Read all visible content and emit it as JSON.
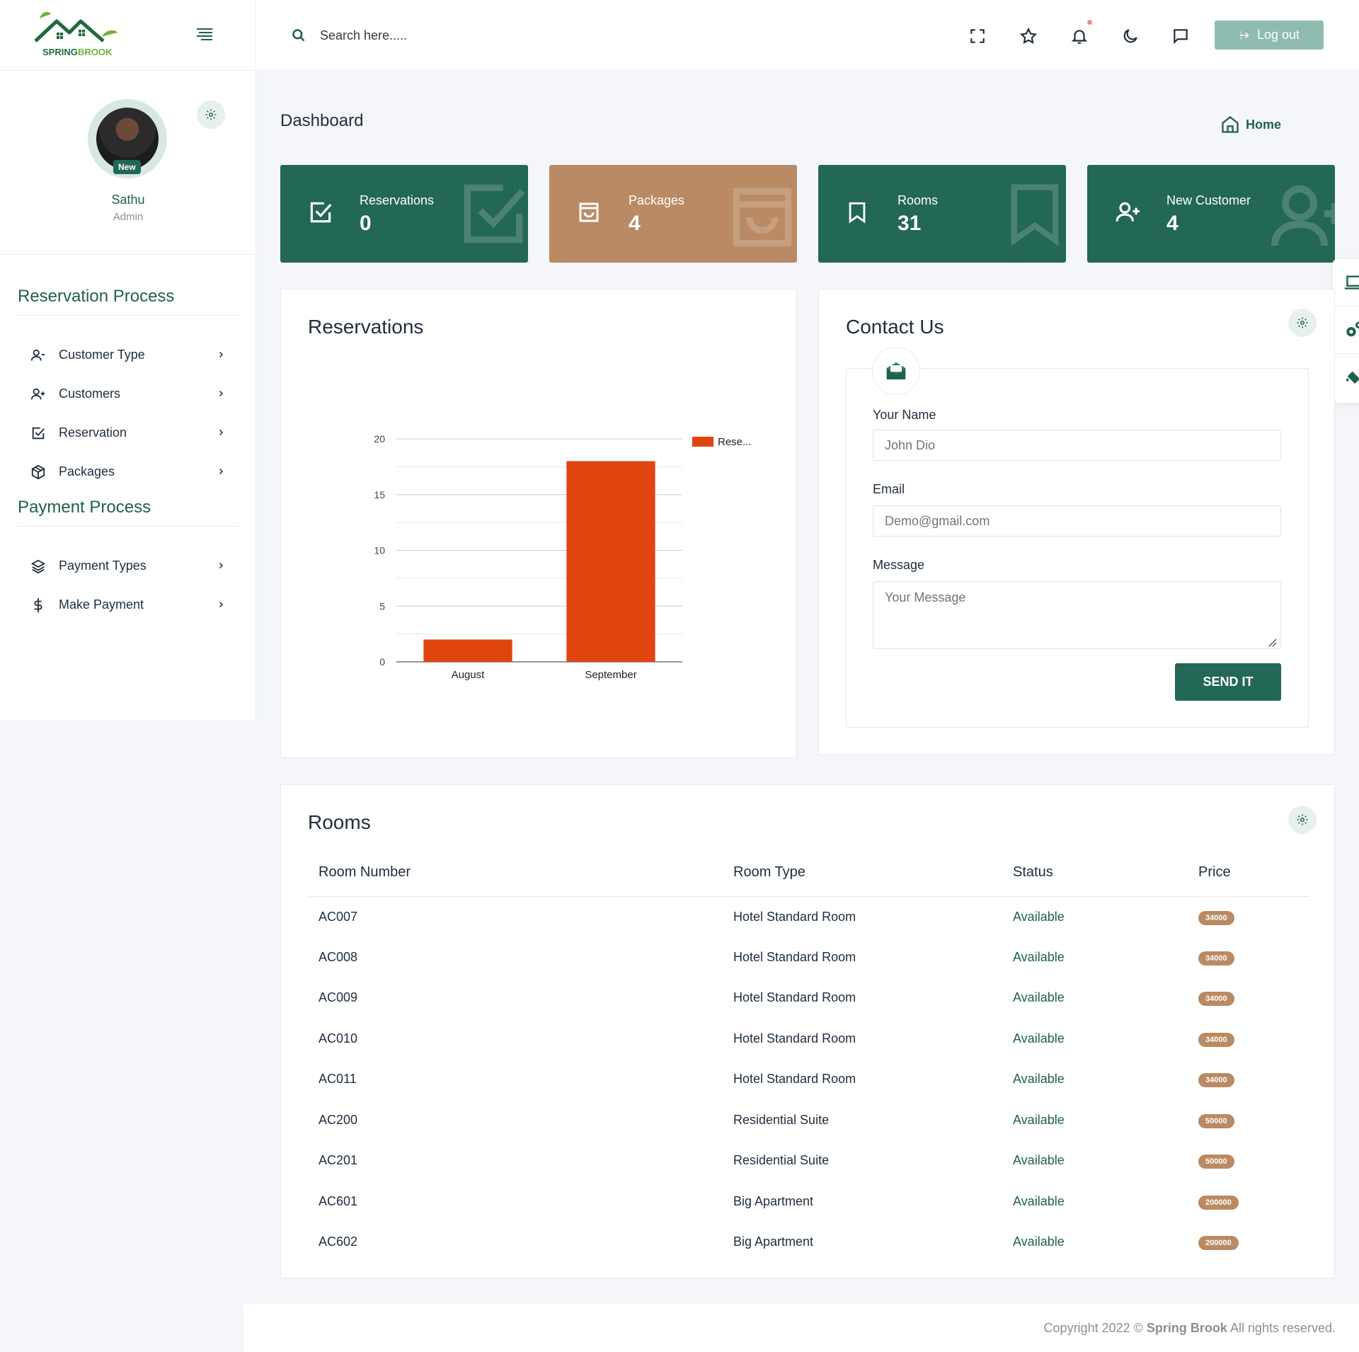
{
  "brand": {
    "logo_text_1": "SPRING",
    "logo_text_2": "BROOK"
  },
  "search": {
    "placeholder": "Search here....."
  },
  "header": {
    "logout_label": "Log out"
  },
  "profile": {
    "name": "Sathu",
    "role": "Admin",
    "badge": "New"
  },
  "sidebar": {
    "section1_title": "Reservation Process",
    "section1_items": [
      {
        "label": "Customer Type",
        "icon": "user-minus-icon"
      },
      {
        "label": "Customers",
        "icon": "user-plus-icon"
      },
      {
        "label": "Reservation",
        "icon": "check-square-icon"
      },
      {
        "label": "Packages",
        "icon": "package-icon"
      }
    ],
    "section2_title": "Payment Process",
    "section2_items": [
      {
        "label": "Payment Types",
        "icon": "layers-icon"
      },
      {
        "label": "Make Payment",
        "icon": "dollar-icon"
      }
    ]
  },
  "page": {
    "title": "Dashboard",
    "breadcrumb_home": "Home"
  },
  "stats": [
    {
      "label": "Reservations",
      "value": "0",
      "color": "#236756"
    },
    {
      "label": "Packages",
      "value": "4",
      "color": "#b98a63"
    },
    {
      "label": "Rooms",
      "value": "31",
      "color": "#236756"
    },
    {
      "label": "New Customer",
      "value": "4",
      "color": "#236756"
    }
  ],
  "reservations_panel": {
    "title": "Reservations"
  },
  "chart_data": {
    "type": "bar",
    "categories": [
      "August",
      "September"
    ],
    "series": [
      {
        "name": "Rese...",
        "values": [
          2,
          18
        ],
        "color": "#e0440f"
      }
    ],
    "ylim": [
      0,
      20
    ],
    "yticks": [
      0,
      5,
      10,
      15,
      20
    ],
    "grid": true,
    "legend": "top-right"
  },
  "contact": {
    "title": "Contact Us",
    "name_label": "Your Name",
    "name_placeholder": "John Dio",
    "email_label": "Email",
    "email_placeholder": "Demo@gmail.com",
    "message_label": "Message",
    "message_placeholder": "Your Message",
    "send_label": "SEND IT"
  },
  "rooms": {
    "title": "Rooms",
    "columns": [
      "Room Number",
      "Room Type",
      "Status",
      "Price"
    ],
    "rows": [
      [
        "AC007",
        "Hotel Standard Room",
        "Available",
        "34000"
      ],
      [
        "AC008",
        "Hotel Standard Room",
        "Available",
        "34000"
      ],
      [
        "AC009",
        "Hotel Standard Room",
        "Available",
        "34000"
      ],
      [
        "AC010",
        "Hotel Standard Room",
        "Available",
        "34000"
      ],
      [
        "AC011",
        "Hotel Standard Room",
        "Available",
        "34000"
      ],
      [
        "AC200",
        "Residential Suite",
        "Available",
        "50000"
      ],
      [
        "AC201",
        "Residential Suite",
        "Available",
        "50000"
      ],
      [
        "AC601",
        "Big Apartment",
        "Available",
        "200000"
      ],
      [
        "AC602",
        "Big Apartment",
        "Available",
        "200000"
      ]
    ]
  },
  "footer": {
    "prefix": "Copyright 2022 ©",
    "brand": "Spring Brook",
    "suffix": "All rights reserved."
  }
}
